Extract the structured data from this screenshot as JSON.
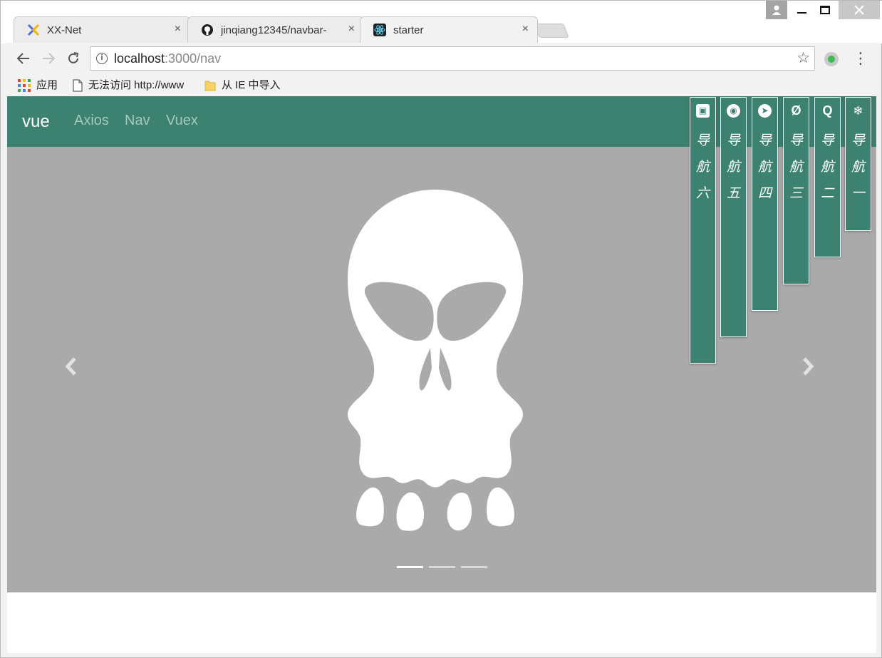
{
  "browser": {
    "tabs": [
      {
        "title": "XX-Net",
        "icon": "xx-net-icon"
      },
      {
        "title": "jinqiang12345/navbar-",
        "icon": "github-icon"
      },
      {
        "title": "starter",
        "icon": "react-icon"
      }
    ],
    "tab_close_glyph": "×",
    "url_host": "localhost",
    "url_rest": ":3000/nav",
    "bookmarks": [
      {
        "label": "应用",
        "icon": "apps-grid-icon"
      },
      {
        "label": "无法访问 http://www",
        "icon": "page-icon"
      },
      {
        "label": "从 IE 中导入",
        "icon": "folder-icon"
      }
    ]
  },
  "app": {
    "brand": "vue",
    "nav_links": [
      "Axios",
      "Nav",
      "Vuex"
    ],
    "carousel": {
      "slide_count": 3,
      "active_index": 0
    },
    "side_nav": [
      {
        "icon": "contacts-icon",
        "glyph": "▣",
        "chars": [
          "导",
          "航",
          "六"
        ]
      },
      {
        "icon": "compass-icon",
        "glyph": "◉",
        "chars": [
          "导",
          "航",
          "五"
        ]
      },
      {
        "icon": "telegram-icon",
        "glyph": "➤",
        "chars": [
          "导",
          "航",
          "四"
        ]
      },
      {
        "icon": "no-symbol-icon",
        "glyph": "Ø",
        "chars": [
          "导",
          "航",
          "三"
        ]
      },
      {
        "icon": "quora-icon",
        "glyph": "Q",
        "chars": [
          "导",
          "航",
          "二"
        ]
      },
      {
        "icon": "snowflake-icon",
        "glyph": "❄",
        "chars": [
          "导",
          "航",
          "一"
        ]
      }
    ]
  },
  "colors": {
    "navbar": "#3d8170",
    "navlink": "#a4c9be",
    "carousel_bg": "#aaaaaa"
  }
}
